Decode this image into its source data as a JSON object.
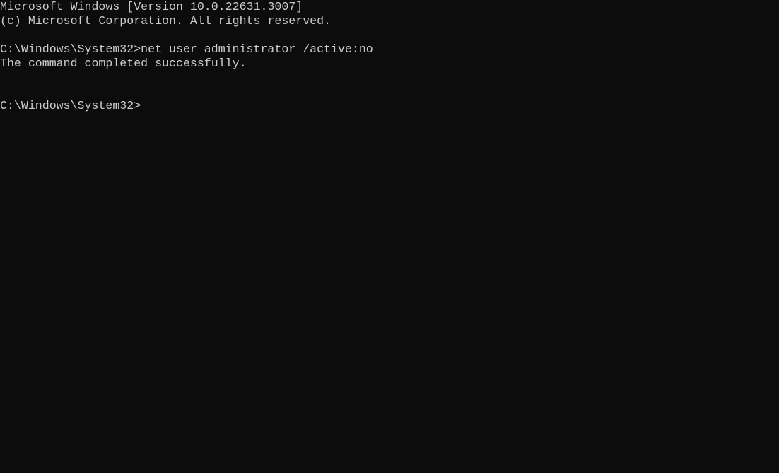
{
  "console": {
    "background": "#0c0c0c",
    "foreground": "#cccccc",
    "lines": [
      "Microsoft Windows [Version 10.0.22631.3007]",
      "(c) Microsoft Corporation. All rights reserved.",
      "",
      "C:\\Windows\\System32>net user administrator /active:no",
      "The command completed successfully.",
      "",
      "",
      "C:\\Windows\\System32>"
    ]
  }
}
